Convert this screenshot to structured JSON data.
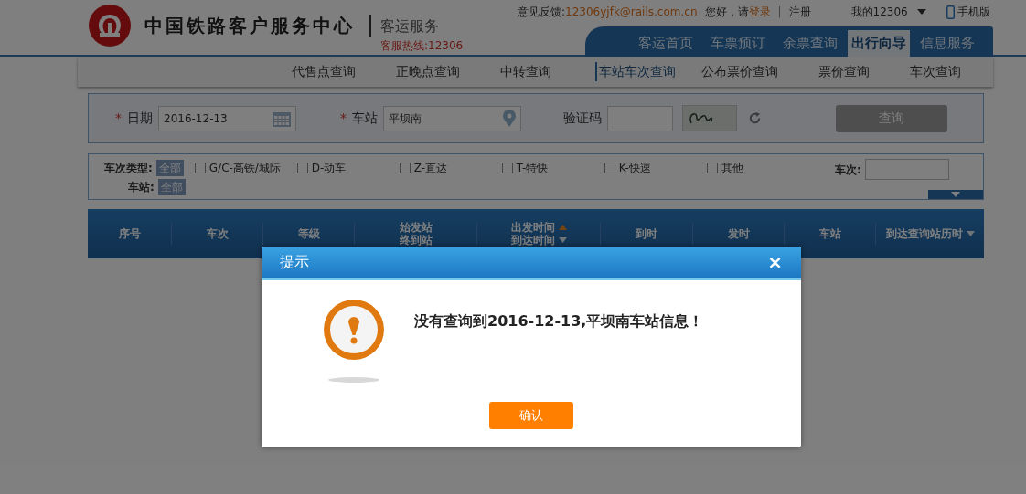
{
  "header": {
    "site_title": "中国铁路客户服务中心",
    "subtitle": "客运服务",
    "hotline": "客服热线:12306",
    "feedback_label": "意见反馈:",
    "feedback_email": "12306yjfk@rails.com.cn",
    "greeting": "您好，请",
    "login": "登录",
    "divider": "|",
    "register": "注册",
    "account": "我的12306",
    "mobile": "手机版"
  },
  "nav_tabs": [
    {
      "label": "客运首页",
      "selected": false
    },
    {
      "label": "车票预订",
      "selected": false
    },
    {
      "label": "余票查询",
      "selected": false
    },
    {
      "label": "出行向导",
      "selected": true
    },
    {
      "label": "信息服务",
      "selected": false
    }
  ],
  "sub_nav": [
    {
      "label": "代售点查询",
      "selected": false
    },
    {
      "label": "正晚点查询",
      "selected": false
    },
    {
      "label": "中转查询",
      "selected": false
    },
    {
      "label": "车站车次查询",
      "selected": true
    },
    {
      "label": "公布票价查询",
      "selected": false
    },
    {
      "label": "票价查询",
      "selected": false
    },
    {
      "label": "车次查询",
      "selected": false
    }
  ],
  "search": {
    "date": {
      "required_mark": "*",
      "label": "日期",
      "value": "2016-12-13"
    },
    "station": {
      "required_mark": "*",
      "label": "车站",
      "value": "平坝南"
    },
    "captcha": {
      "label": "验证码"
    },
    "query_button": {
      "label": "查询",
      "disabled": true
    }
  },
  "filters": {
    "type_label": "车次类型:",
    "type_all": "全部",
    "options": [
      {
        "label": "G/C-高铁/城际",
        "checked": false
      },
      {
        "label": "D-动车",
        "checked": false
      },
      {
        "label": "Z-直达",
        "checked": false
      },
      {
        "label": "T-特快",
        "checked": false
      },
      {
        "label": "K-快速",
        "checked": false
      },
      {
        "label": "其他",
        "checked": false
      }
    ],
    "train_label": "车次:",
    "station_label": "车站:",
    "station_all": "全部"
  },
  "table": {
    "columns": [
      {
        "lines": [
          {
            "text": "序号"
          }
        ]
      },
      {
        "lines": [
          {
            "text": "车次"
          }
        ]
      },
      {
        "lines": [
          {
            "text": "等级"
          }
        ]
      },
      {
        "lines": [
          {
            "text": "始发站"
          },
          {
            "text": "终到站"
          }
        ]
      },
      {
        "lines": [
          {
            "text": "出发时间",
            "kind": "sort_up"
          },
          {
            "text": "到达时间",
            "kind": "sort_down"
          }
        ]
      },
      {
        "lines": [
          {
            "text": "到时"
          }
        ]
      },
      {
        "lines": [
          {
            "text": "发时"
          }
        ]
      },
      {
        "lines": [
          {
            "text": "车站"
          }
        ]
      },
      {
        "lines": [
          {
            "text": "到达查询站历时",
            "kind": "menu"
          }
        ]
      }
    ]
  },
  "dialog": {
    "title": "提示",
    "close": "×",
    "message": "没有查询到2016-12-13,平坝南车站信息！",
    "confirm": "确认"
  }
}
